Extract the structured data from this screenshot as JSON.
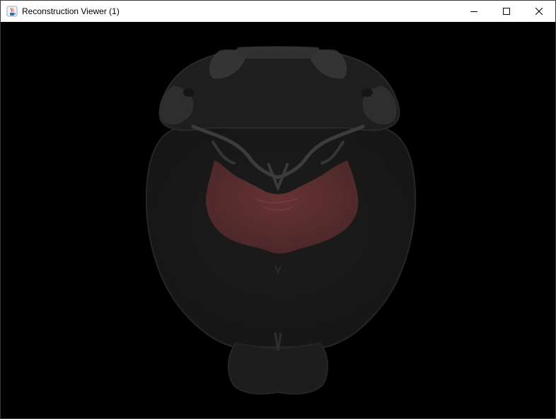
{
  "window": {
    "title": "Reconstruction Viewer (1)",
    "app_icon": "java-cup-icon",
    "controls": [
      "minimize-icon",
      "maximize-icon",
      "close-icon"
    ]
  },
  "viewer": {
    "background": "#000000",
    "brain_fill": "#1b1b1b",
    "brain_highlight": "#2c2c2c",
    "region_color": "#5a2e30",
    "region_highlight": "#7a3e40"
  }
}
